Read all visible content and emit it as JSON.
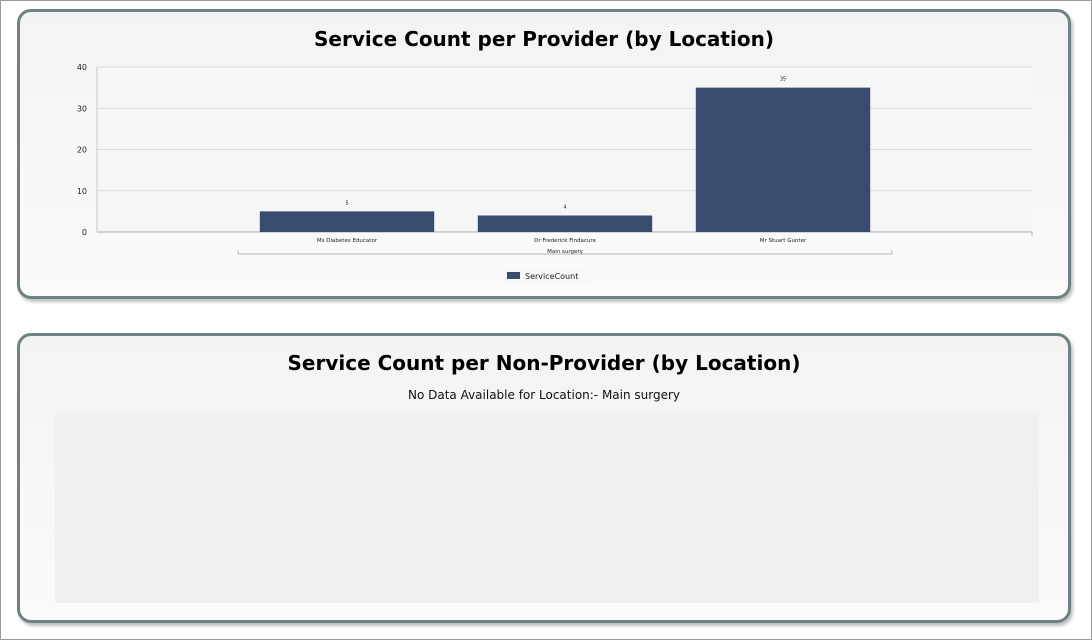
{
  "chart_data": {
    "type": "bar",
    "title": "Service Count per Provider (by Location)",
    "categories": [
      "Ms Diabetes Educator",
      "Dr Frederick Findacure",
      "Mr Stuart Gunter"
    ],
    "group_label": "Main surgery",
    "series": [
      {
        "name": "ServiceCount",
        "values": [
          5,
          4,
          35
        ],
        "color": "#384c6e"
      }
    ],
    "ylim": [
      0,
      40
    ],
    "yticks": [
      0,
      10,
      20,
      30,
      40
    ],
    "grid": true,
    "legend": "bottom"
  },
  "non_provider": {
    "title": "Service Count per Non-Provider (by Location)",
    "message": "No Data Available for Location:- Main surgery"
  }
}
